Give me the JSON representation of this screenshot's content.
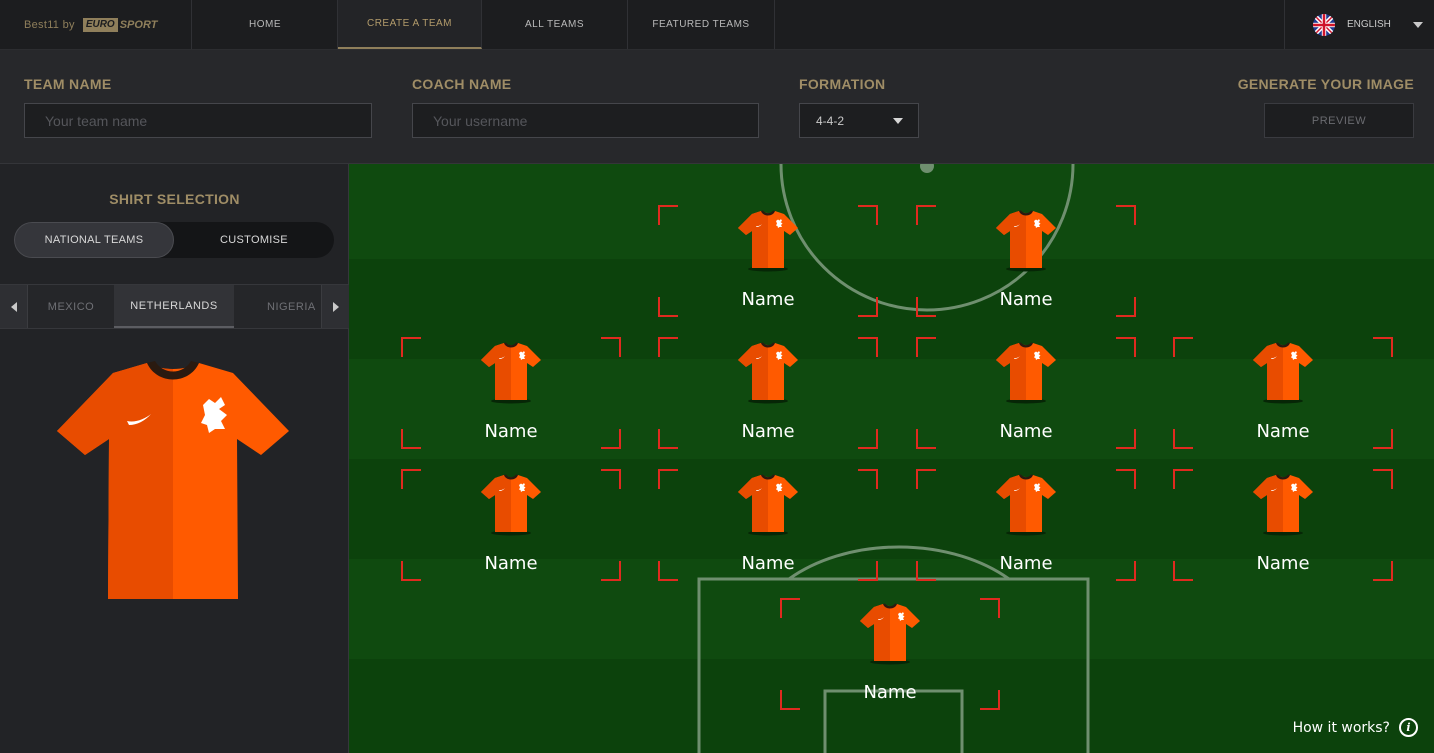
{
  "brand": {
    "prefix": "Best11 by",
    "logo_euro": "EURO",
    "logo_sport": "SPORT"
  },
  "nav": {
    "items": [
      {
        "label": "HOME",
        "active": false
      },
      {
        "label": "CREATE A TEAM",
        "active": true
      },
      {
        "label": "ALL TEAMS",
        "active": false
      },
      {
        "label": "FEATURED TEAMS",
        "active": false
      }
    ],
    "language": {
      "label": "ENGLISH",
      "icon": "uk-flag-icon"
    }
  },
  "form": {
    "team_name": {
      "label": "TEAM NAME",
      "placeholder": "Your team name",
      "value": ""
    },
    "coach_name": {
      "label": "COACH NAME",
      "placeholder": "Your username",
      "value": ""
    },
    "formation": {
      "label": "FORMATION",
      "selected": "4-4-2"
    },
    "generate": {
      "label": "GENERATE YOUR IMAGE",
      "button": "PREVIEW"
    }
  },
  "sidebar": {
    "title": "SHIRT SELECTION",
    "tabs": [
      {
        "label": "NATIONAL TEAMS",
        "active": true
      },
      {
        "label": "CUSTOMISE",
        "active": false
      }
    ],
    "countries": [
      {
        "label": "MEXICO",
        "active": false
      },
      {
        "label": "NETHERLANDS",
        "active": true
      },
      {
        "label": "NIGERIA",
        "active": false
      }
    ],
    "shirt": {
      "primary": "#ff5a00",
      "shade": "#e84c00",
      "collar": "#2a1a10"
    }
  },
  "pitch": {
    "colors": {
      "grass_light": "#0f4a0f",
      "grass_dark": "#0b3e0b",
      "lines": "#6f8f6f",
      "slot_corner": "#e02a1f"
    },
    "players": [
      {
        "name": "Name"
      },
      {
        "name": "Name"
      },
      {
        "name": "Name"
      },
      {
        "name": "Name"
      },
      {
        "name": "Name"
      },
      {
        "name": "Name"
      },
      {
        "name": "Name"
      },
      {
        "name": "Name"
      },
      {
        "name": "Name"
      },
      {
        "name": "Name"
      },
      {
        "name": "Name"
      }
    ],
    "help_label": "How it works?"
  }
}
